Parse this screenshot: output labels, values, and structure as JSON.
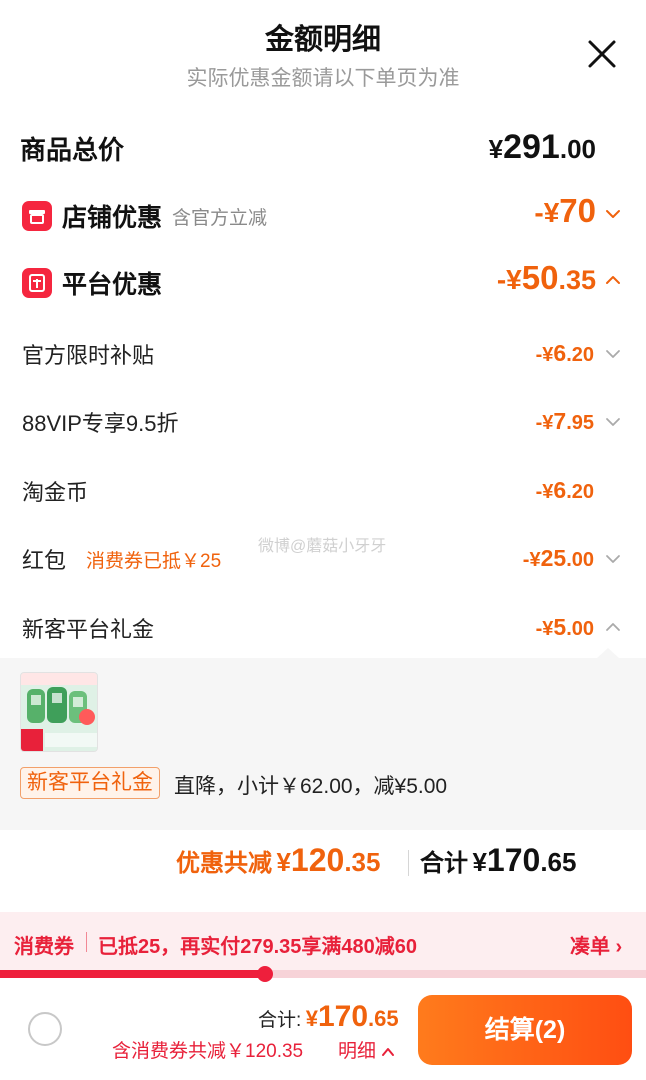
{
  "header": {
    "title": "金额明细",
    "subtitle": "实际优惠金额请以下单页为准"
  },
  "goods_total": {
    "label": "商品总价",
    "yen": "¥",
    "int": "291",
    "dec": ".00"
  },
  "shop_discount": {
    "label": "店铺优惠",
    "note": "含官方立减",
    "prefix": "-¥",
    "int": "70",
    "dec": ""
  },
  "platform_discount": {
    "label": "平台优惠",
    "prefix": "-¥",
    "int": "50",
    "dec": ".35"
  },
  "rows": [
    {
      "label": "官方限时补贴",
      "prefix": "-¥",
      "int": "6",
      "dec": ".20",
      "note": ""
    },
    {
      "label": "88VIP专享9.5折",
      "prefix": "-¥",
      "int": "7",
      "dec": ".95",
      "note": ""
    },
    {
      "label": "淘金币",
      "prefix": "-¥",
      "int": "6",
      "dec": ".20",
      "note": ""
    },
    {
      "label": "红包",
      "prefix": "-¥",
      "int": "25",
      "dec": ".00",
      "note": "消费券已抵￥25"
    },
    {
      "label": "新客平台礼金",
      "prefix": "-¥",
      "int": "5",
      "dec": ".00",
      "note": ""
    }
  ],
  "watermark": "微博@蘑菇小牙牙",
  "detail": {
    "tag": "新客平台礼金",
    "desc": "直降，小计￥62.00，减¥5.00"
  },
  "summary": {
    "discount_label": "优惠共减",
    "discount_yen": "¥",
    "discount_int": "120",
    "discount_dec": ".35",
    "total_label": "合计",
    "total_yen": "¥",
    "total_int": "170",
    "total_dec": ".65"
  },
  "coupon": {
    "title": "消费券",
    "desc": "已抵25，再实付279.35享满480减60",
    "link": "凑单 ›",
    "progress": 0.41
  },
  "footer": {
    "total_label": "合计:",
    "total_yen": "¥",
    "total_int": "170",
    "total_dec": ".65",
    "note": "含消费券共减￥120.35",
    "detail_link": "明细",
    "checkout": "结算(2)"
  },
  "colors": {
    "accent_orange": "#f0620d",
    "accent_red": "#e8213a",
    "checkout_gradient_start": "#ff7b1c",
    "checkout_gradient_end": "#ff4e12"
  }
}
